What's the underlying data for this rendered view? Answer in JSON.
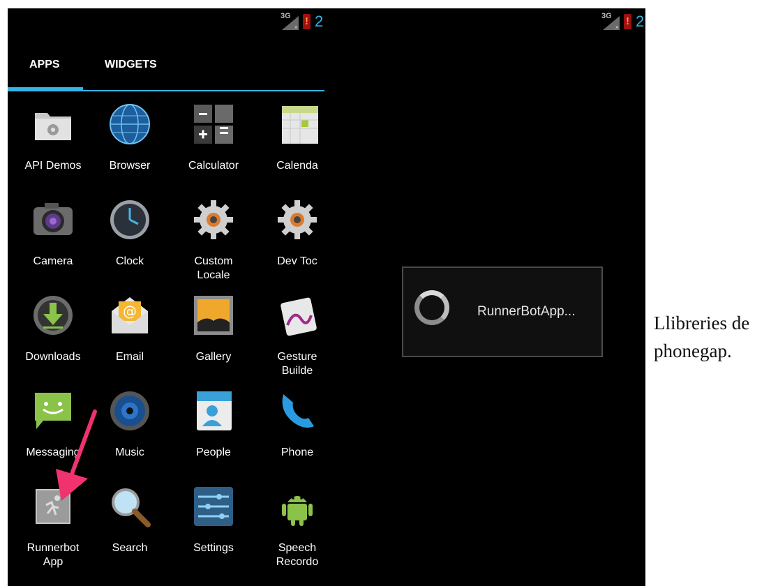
{
  "left_screen": {
    "status": {
      "network": "3G",
      "clock_partial": "2"
    },
    "tabs": [
      {
        "label": "APPS"
      },
      {
        "label": "WIDGETS"
      }
    ],
    "apps": [
      {
        "label": "API Demos",
        "icon": "folder-gear-icon"
      },
      {
        "label": "Browser",
        "icon": "globe-icon"
      },
      {
        "label": "Calculator",
        "icon": "calculator-icon"
      },
      {
        "label": "Calenda",
        "icon": "calendar-icon"
      },
      {
        "label": "Camera",
        "icon": "camera-icon"
      },
      {
        "label": "Clock",
        "icon": "clock-icon"
      },
      {
        "label": "Custom\nLocale",
        "icon": "gear-icon"
      },
      {
        "label": "Dev Toc",
        "icon": "gear-icon"
      },
      {
        "label": "Downloads",
        "icon": "download-icon"
      },
      {
        "label": "Email",
        "icon": "email-icon"
      },
      {
        "label": "Gallery",
        "icon": "gallery-icon"
      },
      {
        "label": "Gesture\nBuilde",
        "icon": "gesture-icon"
      },
      {
        "label": "Messaging",
        "icon": "messaging-icon"
      },
      {
        "label": "Music",
        "icon": "speaker-icon"
      },
      {
        "label": "People",
        "icon": "contact-card-icon"
      },
      {
        "label": "Phone",
        "icon": "phone-icon"
      },
      {
        "label": "Runnerbot\nApp",
        "icon": "runner-icon"
      },
      {
        "label": "Search",
        "icon": "magnifier-icon"
      },
      {
        "label": "Settings",
        "icon": "sliders-icon"
      },
      {
        "label": "Speech\nRecordo",
        "icon": "android-icon"
      }
    ]
  },
  "right_screen": {
    "status": {
      "network": "3G",
      "clock_partial": "2"
    },
    "dialog": {
      "message": "RunnerBotApp..."
    }
  },
  "caption": {
    "line1": "Llibreries de",
    "line2": "phonegap."
  },
  "colors": {
    "accent": "#33b5e5",
    "arrow": "#f0326e",
    "background": "#000000"
  }
}
